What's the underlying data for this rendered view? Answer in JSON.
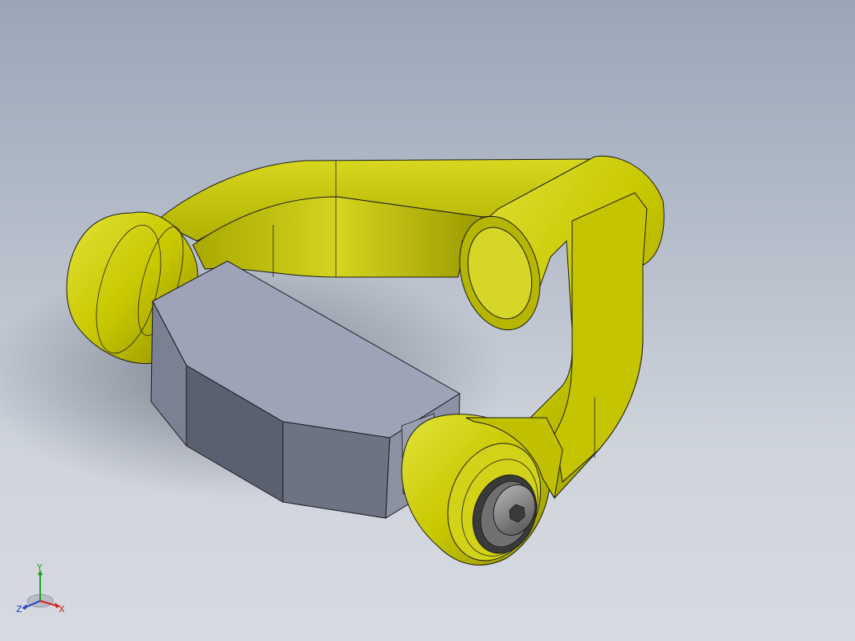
{
  "viewport": {
    "background_top": "#9aa6b8",
    "background_bottom": "#d6dae1"
  },
  "model": {
    "colors": {
      "yoke_yellow": "#c8c800",
      "yoke_highlight": "#e8e860",
      "yoke_shadow": "#7d7d00",
      "block_light": "#9ea3b8",
      "block_mid": "#6d7285",
      "block_dark": "#4a4e5c",
      "edge": "#1a1a1a"
    }
  },
  "triad": {
    "x_label": "X",
    "y_label": "Y",
    "z_label": "Z",
    "x_color": "#d02020",
    "y_color": "#20a020",
    "z_color": "#2040c0"
  }
}
